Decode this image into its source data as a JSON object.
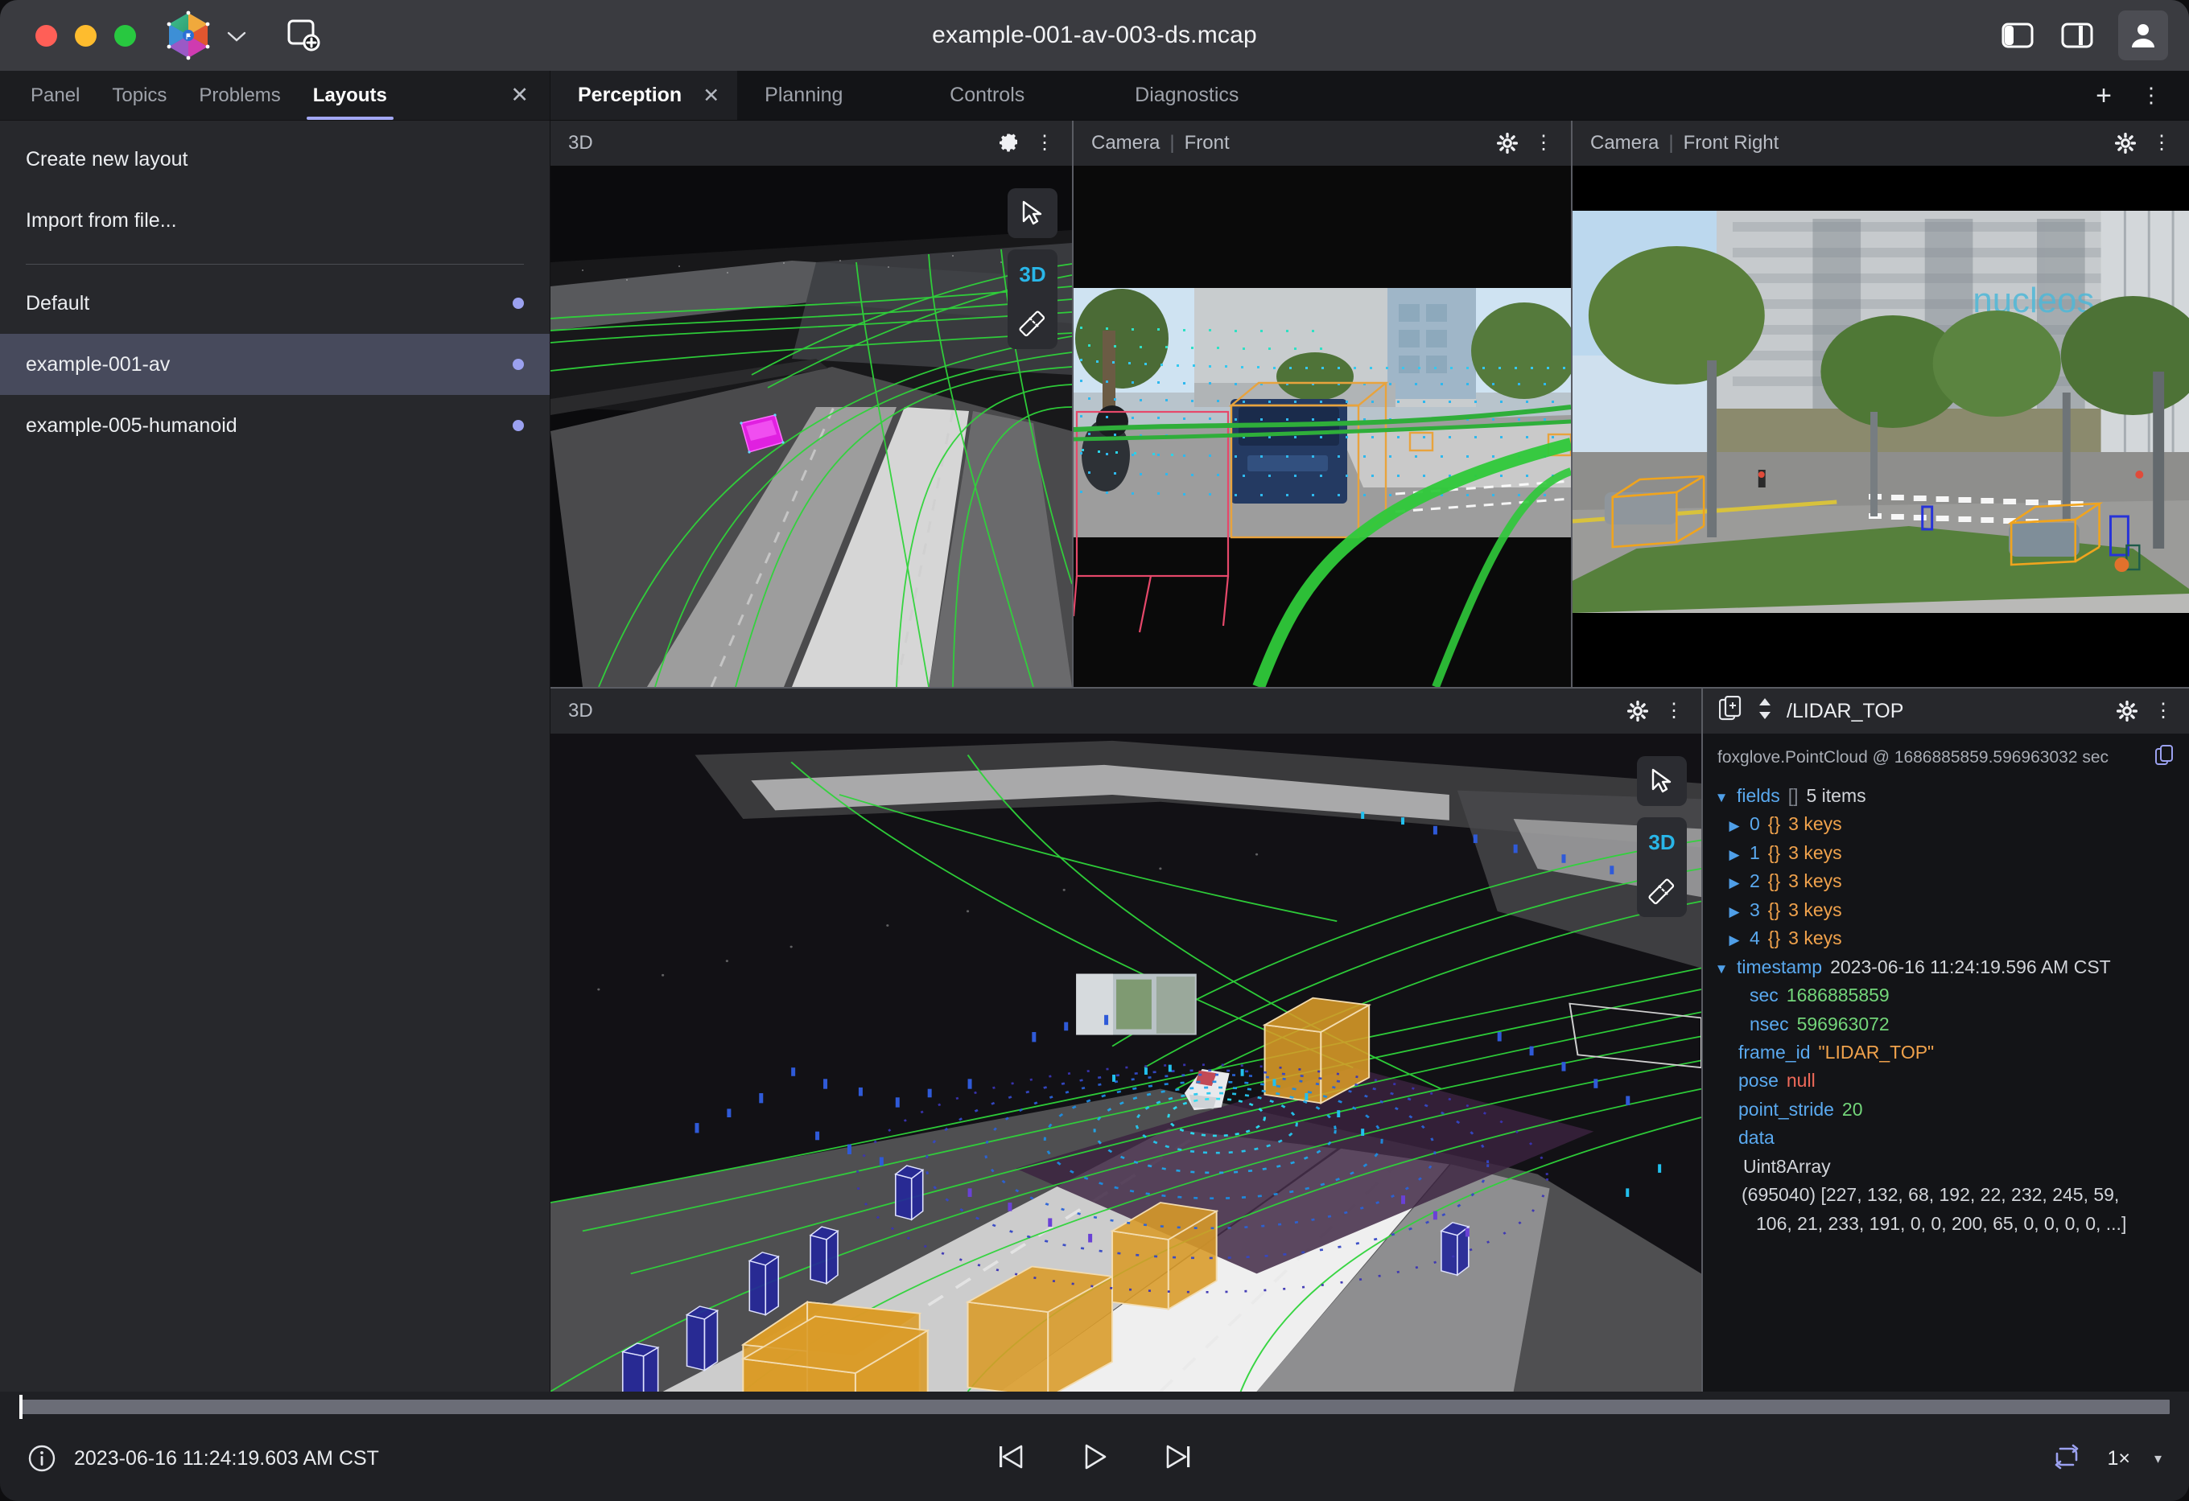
{
  "window": {
    "title": "example-001-av-003-ds.mcap",
    "traffic_lights": [
      "close",
      "minimize",
      "maximize"
    ],
    "app_logo": "foxglove-logo-icon",
    "logo_dropdown": "chevron-down-icon",
    "new_panel": "add-panel-icon",
    "left_sidebar_toggle": "left-sidebar-icon",
    "right_sidebar_toggle": "right-sidebar-icon",
    "account": "user-avatar-icon"
  },
  "sidebar": {
    "tabs": [
      {
        "label": "Panel",
        "active": false
      },
      {
        "label": "Topics",
        "active": false
      },
      {
        "label": "Problems",
        "active": false
      },
      {
        "label": "Layouts",
        "active": true
      }
    ],
    "close_label": "✕",
    "actions": [
      {
        "label": "Create new layout"
      },
      {
        "label": "Import from file..."
      }
    ],
    "layouts": [
      {
        "label": "Default",
        "selected": false,
        "badge": "●"
      },
      {
        "label": "example-001-av",
        "selected": true,
        "badge": "●"
      },
      {
        "label": "example-005-humanoid",
        "selected": false,
        "badge": "●"
      }
    ]
  },
  "workspace": {
    "tabs": [
      {
        "label": "Perception",
        "active": true,
        "close": "✕"
      },
      {
        "label": "Planning",
        "active": false
      },
      {
        "label": "Controls",
        "active": false
      },
      {
        "label": "Diagnostics",
        "active": false
      }
    ],
    "add_tab": "+",
    "tab_menu": "⋮"
  },
  "panels": {
    "three_d_top": {
      "title": "3D",
      "settings": "gear-icon",
      "menu": "⋮",
      "tools": [
        {
          "name": "cursor-tool",
          "label": ""
        },
        {
          "name": "three-d-tool",
          "label": "3D"
        },
        {
          "name": "measure-tool",
          "label": ""
        }
      ]
    },
    "camera_front": {
      "title_prefix": "Camera",
      "separator": "|",
      "title_suffix": "Front",
      "settings": "gear-icon",
      "menu": "⋮"
    },
    "camera_front_right": {
      "title_prefix": "Camera",
      "separator": "|",
      "title_suffix": "Front Right",
      "settings": "gear-icon",
      "menu": "⋮"
    },
    "three_d_bottom": {
      "title": "3D",
      "settings": "gear-icon",
      "menu": "⋮",
      "tools": [
        {
          "name": "cursor-tool",
          "label": ""
        },
        {
          "name": "three-d-tool",
          "label": "3D"
        },
        {
          "name": "measure-tool",
          "label": ""
        }
      ]
    },
    "raw_messages": {
      "copy_icon": "copy-message-icon",
      "sort_icon": "expand-collapse-icon",
      "topic": "/LIDAR_TOP",
      "settings": "gear-icon",
      "menu": "⋮",
      "schema_line": "foxglove.PointCloud @ 1686885859.596963032 sec",
      "copy_button": "copy-icon",
      "tree": {
        "fields_key": "fields",
        "fields_type": "[]",
        "fields_count": "5 items",
        "items": [
          {
            "index": "0",
            "braces": "{}",
            "count": "3 keys"
          },
          {
            "index": "1",
            "braces": "{}",
            "count": "3 keys"
          },
          {
            "index": "2",
            "braces": "{}",
            "count": "3 keys"
          },
          {
            "index": "3",
            "braces": "{}",
            "count": "3 keys"
          },
          {
            "index": "4",
            "braces": "{}",
            "count": "3 keys"
          }
        ],
        "timestamp_key": "timestamp",
        "timestamp_value": "2023-06-16 11:24:19.596 AM CST",
        "sec_key": "sec",
        "sec_value": "1686885859",
        "nsec_key": "nsec",
        "nsec_value": "596963072",
        "frame_id_key": "frame_id",
        "frame_id_value": "\"LIDAR_TOP\"",
        "pose_key": "pose",
        "pose_value": "null",
        "point_stride_key": "point_stride",
        "point_stride_value": "20",
        "data_key": "data",
        "data_type": "Uint8Array",
        "data_value_line1": "(695040) [227, 132, 68, 192, 22, 232, 245, 59,",
        "data_value_line2": "106, 21, 233, 191, 0, 0, 200, 65, 0, 0, 0, 0, ...]"
      }
    }
  },
  "playback": {
    "info_icon": "info-icon",
    "timestamp": "2023-06-16 11:24:19.603 AM CST",
    "seek_backward": "skip-previous-icon",
    "play": "play-icon",
    "seek_forward": "skip-next-icon",
    "loop": "repeat-icon",
    "speed": "1×",
    "speed_caret": "▾",
    "progress_percent": 0.5
  },
  "colors": {
    "accent": "#a3a8f5",
    "titlebar": "#3a3b40",
    "sidebar": "#27282c",
    "panel_header": "#27282c",
    "tab_active_bg": "#1f2024",
    "selection": "#474a5c",
    "key_blue": "#5aa9ef",
    "number_green": "#73d67a",
    "string_orange": "#f0a24c",
    "null_red": "#f06a5a",
    "loop_active": "#9ba1f0",
    "lane_green": "#2fd43a",
    "bbox_orange": "#e8a33d",
    "bbox_blue": "#3a3ad0",
    "ego_magenta": "#e020e0"
  }
}
